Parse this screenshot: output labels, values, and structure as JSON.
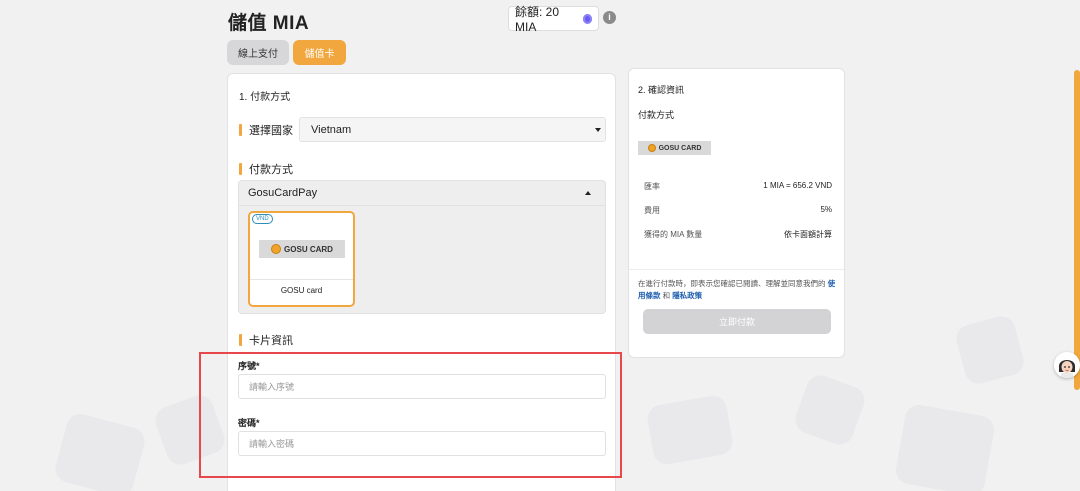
{
  "header": {
    "title": "儲值 MIA",
    "balance_label": "餘額: 20 MIA",
    "info_icon": "info-icon",
    "info_glyph": "i"
  },
  "tabs": [
    {
      "label": "線上支付",
      "active": false
    },
    {
      "label": "儲值卡",
      "active": true
    }
  ],
  "payment": {
    "section_title": "1. 付款方式",
    "country_label": "選擇國家",
    "country_value": "Vietnam",
    "method_label": "付款方式",
    "method_selected": "GosuCardPay",
    "card_option": {
      "badge": "VND",
      "logo_text": "GOSU CARD",
      "name": "GOSU card"
    },
    "card_info_label": "卡片資訊",
    "serial_label": "序號*",
    "serial_placeholder": "請輸入序號",
    "password_label": "密碼*",
    "password_placeholder": "請輸入密碼"
  },
  "confirm": {
    "title": "2. 確認資訊",
    "method_label": "付款方式",
    "logo_text": "GOSU CARD",
    "rows": [
      {
        "key": "匯率",
        "value": "1 MIA = 656.2 VND"
      },
      {
        "key": "費用",
        "value": "5%"
      },
      {
        "key": "獲得的 MIA 數量",
        "value": "依卡面額計算"
      }
    ],
    "terms_prefix": "在進行付款時，即表示您確認已閱讀、理解並同意我們的",
    "terms_link": "使用條款",
    "terms_and": "和",
    "privacy_link": "隱私政策",
    "pay_button": "立即付款"
  },
  "colors": {
    "accent": "#f1a73d",
    "highlight": "#e8484b",
    "link": "#1f5fae"
  }
}
